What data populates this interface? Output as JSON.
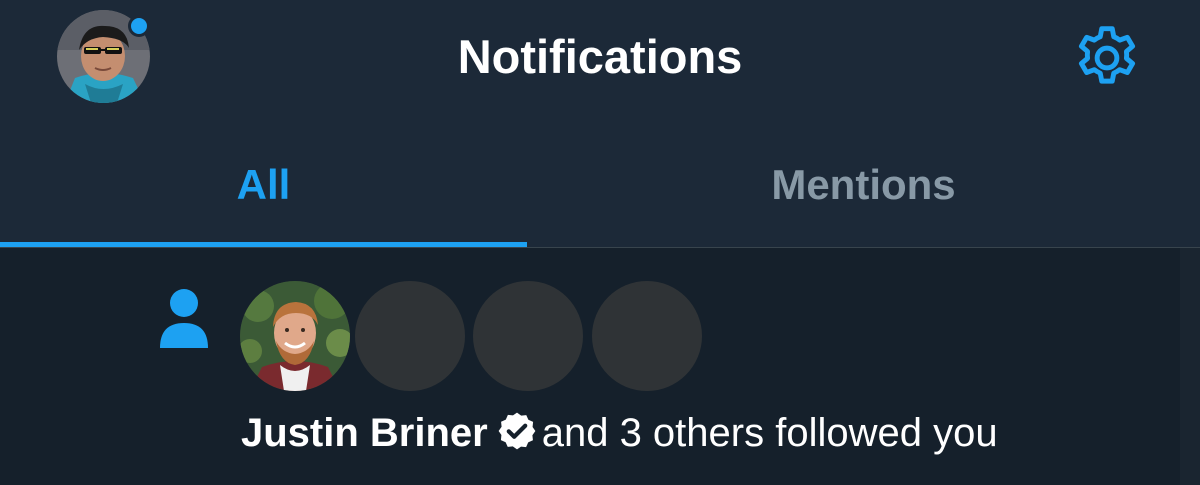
{
  "header": {
    "title": "Notifications",
    "settings_icon": "gear-icon",
    "profile_avatar": "profile-avatar",
    "unread_dot_color": "#1da1f2"
  },
  "tabs": [
    {
      "label": "All",
      "active": true
    },
    {
      "label": "Mentions",
      "active": false
    }
  ],
  "notification": {
    "type": "follow",
    "icon": "person-icon",
    "name": "Justin Briner",
    "verified": true,
    "rest": "and 3 others followed you",
    "avatar_count": 4
  },
  "colors": {
    "accent": "#1da1f2",
    "background": "#15202b",
    "header": "#1c2938",
    "muted": "#8899a6"
  }
}
